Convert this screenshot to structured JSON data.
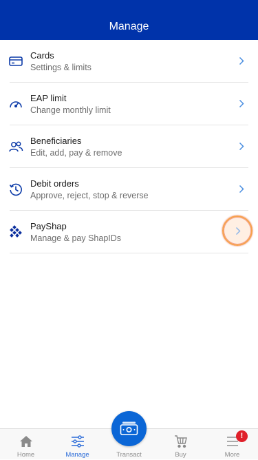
{
  "header": {
    "title": "Manage"
  },
  "menu": {
    "items": [
      {
        "title": "Cards",
        "subtitle": "Settings & limits",
        "icon": "card-icon"
      },
      {
        "title": "EAP limit",
        "subtitle": "Change monthly limit",
        "icon": "gauge-icon"
      },
      {
        "title": "Beneficiaries",
        "subtitle": "Edit, add, pay & remove",
        "icon": "people-icon"
      },
      {
        "title": "Debit orders",
        "subtitle": "Approve, reject, stop & reverse",
        "icon": "clock-history-icon"
      },
      {
        "title": "PayShap",
        "subtitle": "Manage & pay ShapIDs",
        "icon": "payshap-logo-icon"
      }
    ]
  },
  "tabbar": {
    "tabs": [
      {
        "label": "Home",
        "icon": "home-icon",
        "active": false
      },
      {
        "label": "Manage",
        "icon": "sliders-icon",
        "active": true
      },
      {
        "label": "Transact",
        "icon": "cash-icon",
        "active": false
      },
      {
        "label": "Buy",
        "icon": "cart-icon",
        "active": false
      },
      {
        "label": "More",
        "icon": "menu-icon",
        "active": false
      }
    ],
    "more_badge": "!"
  },
  "colors": {
    "brand": "#0033aa",
    "accent": "#2a6bd8",
    "fab": "#0b66d6",
    "chevron": "#4a8ee0",
    "badge": "#e0202a"
  }
}
